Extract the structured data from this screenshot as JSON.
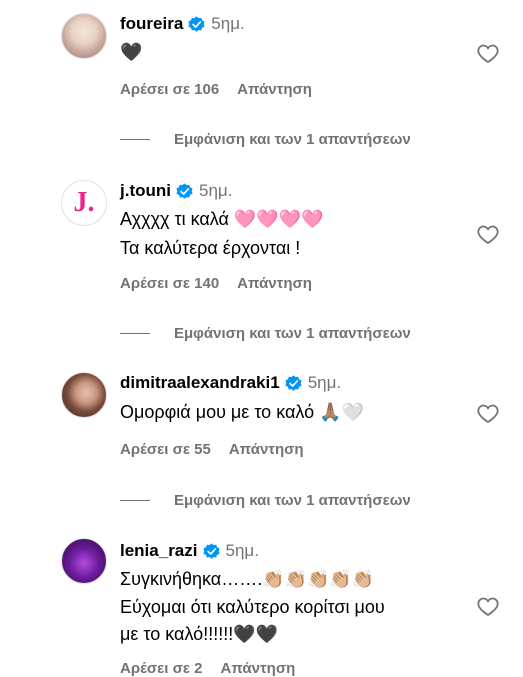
{
  "comments": [
    {
      "username": "foureira",
      "time": "5ημ.",
      "lines": [
        "🖤"
      ],
      "likes": "Αρέσει σε 106",
      "reply": "Απάντηση",
      "view_replies": "Εμφάνιση και των 1 απαντήσεων"
    },
    {
      "username": "j.touni",
      "avatar_letter": "J.",
      "time": "5ημ.",
      "lines": [
        "Αχχχχ τι καλά 🩷🩷🩷🩷",
        "Τα καλύτερα έρχονται !"
      ],
      "likes": "Αρέσει σε 140",
      "reply": "Απάντηση",
      "view_replies": "Εμφάνιση και των 1 απαντήσεων"
    },
    {
      "username": "dimitraalexandraki1",
      "time": "5ημ.",
      "lines": [
        "Ομορφιά μου με το καλό 🙏🏽🤍"
      ],
      "likes": "Αρέσει σε 55",
      "reply": "Απάντηση",
      "view_replies": "Εμφάνιση και των 1 απαντήσεων"
    },
    {
      "username": "lenia_razi",
      "time": "5ημ.",
      "lines": [
        "Συγκινήθηκα…….👏🏼👏🏼👏🏼👏🏼👏🏼",
        "Εύχομαι ότι καλύτερο κορίτσι μου",
        "με το καλό!!!!!!🖤🖤"
      ],
      "likes": "Αρέσει σε 2",
      "reply": "Απάντηση"
    }
  ],
  "colors": {
    "verified": "#0095f6",
    "secondary": "#737373",
    "text": "#000000"
  },
  "icons": {
    "like": "heart-outline-icon",
    "verified": "verified-badge-icon"
  }
}
